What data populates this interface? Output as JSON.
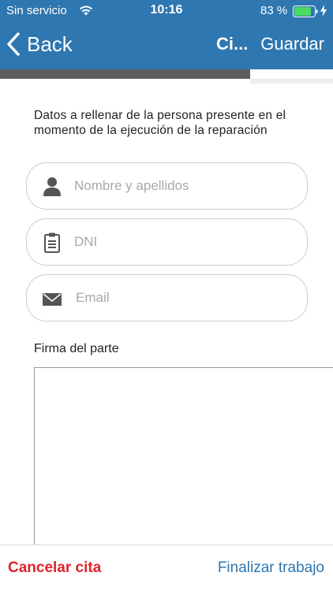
{
  "status_bar": {
    "carrier": "Sin servicio",
    "time": "10:16",
    "battery": "83 %"
  },
  "nav": {
    "back_label": "Back",
    "title": "Ci...",
    "save_label": "Guardar"
  },
  "progress": {
    "fraction": 0.75
  },
  "form": {
    "intro": "Datos a rellenar de la persona presente en el momento de la ejecución de la reparación",
    "name_placeholder": "Nombre y apellidos",
    "dni_placeholder": "DNI",
    "email_placeholder": "Email",
    "signature_label": "Firma del parte"
  },
  "footer": {
    "cancel_label": "Cancelar cita",
    "finish_label": "Finalizar trabajo"
  },
  "colors": {
    "header": "#2f77b0",
    "cancel": "#e0232a",
    "accent": "#2f77b0"
  },
  "icons": {
    "wifi": "wifi-icon",
    "battery": "battery-icon",
    "back": "chevron-left-icon",
    "name": "person-icon",
    "dni": "clipboard-icon",
    "email": "envelope-icon"
  }
}
